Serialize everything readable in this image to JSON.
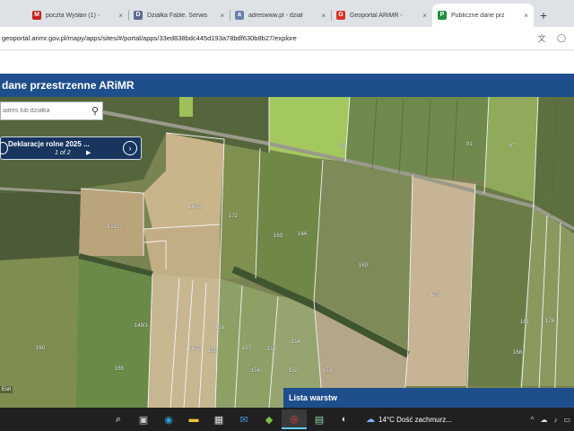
{
  "browser": {
    "tabs": [
      {
        "title": "poczta Wysłan (1) -",
        "favicon_color": "#c5221f",
        "favicon_glyph": "M",
        "active": false
      },
      {
        "title": "Działka Fable. Serwis",
        "favicon_color": "#5b6b8c",
        "favicon_glyph": "D",
        "active": false
      },
      {
        "title": "adreswww.pl - dział",
        "favicon_color": "#6a7fa8",
        "favicon_glyph": "a",
        "active": false
      },
      {
        "title": "Geoportal ARiMR -",
        "favicon_color": "#d93025",
        "favicon_glyph": "G",
        "active": false
      },
      {
        "title": "Publiczne dane prz",
        "favicon_color": "#1e8e3e",
        "favicon_glyph": "P",
        "active": true
      }
    ],
    "close_glyph": "×",
    "newtab_glyph": "+",
    "url": "geoportal.arimr.gov.pl/mapy/apps/sites/#/portal/apps/33ed838bdc445d193a78bdf630b8b27/explore",
    "translate_icon": "translate-icon",
    "account_icon": "profile-icon"
  },
  "app": {
    "title": "dane przestrzenne ARiMR",
    "search": {
      "placeholder": "adres lub działka"
    },
    "popup": {
      "title": "Deklaracje rolne 2025 ...",
      "count": "1 of 2",
      "arrow": "▶",
      "next_glyph": "›"
    },
    "map_credit": "Esri",
    "layers_panel": {
      "label": "Lista warstw"
    },
    "parcel_labels": [
      "89",
      "87",
      "81",
      "148/2",
      "151/3",
      "163",
      "164",
      "169",
      "170",
      "172",
      "176",
      "151",
      "149/1",
      "161",
      "157",
      "153",
      "152",
      "154",
      "156",
      "145/2",
      "150",
      "158",
      "160",
      "165",
      "168"
    ]
  },
  "taskbar": {
    "apps": [
      {
        "icon": "search-icon",
        "glyph": "⌕",
        "color": "#ffffff",
        "active": false
      },
      {
        "icon": "task-view-icon",
        "glyph": "▣",
        "color": "#cccccc",
        "active": false
      },
      {
        "icon": "edge-icon",
        "glyph": "◉",
        "color": "#2f9cd8",
        "active": false
      },
      {
        "icon": "file-explorer-icon",
        "glyph": "▬",
        "color": "#f0c23a",
        "active": false
      },
      {
        "icon": "store-icon",
        "glyph": "▦",
        "color": "#e0e0e0",
        "active": false
      },
      {
        "icon": "mail-icon",
        "glyph": "✉",
        "color": "#3c8de0",
        "active": false
      },
      {
        "icon": "app-icon",
        "glyph": "◆",
        "color": "#7bc043",
        "active": false
      },
      {
        "icon": "chrome-icon",
        "glyph": "◎",
        "color": "#e8453c",
        "active": true
      },
      {
        "icon": "document-icon",
        "glyph": "▤",
        "color": "#8fd3a8",
        "active": false
      },
      {
        "icon": "paint-icon",
        "glyph": "◐",
        "color": "#d0d0d0",
        "active": false
      }
    ],
    "weather": {
      "temp": "14°C",
      "desc": "Dość zachmurz..."
    },
    "tray_glyphs": [
      "^",
      "☁",
      "♪",
      "▭"
    ]
  }
}
